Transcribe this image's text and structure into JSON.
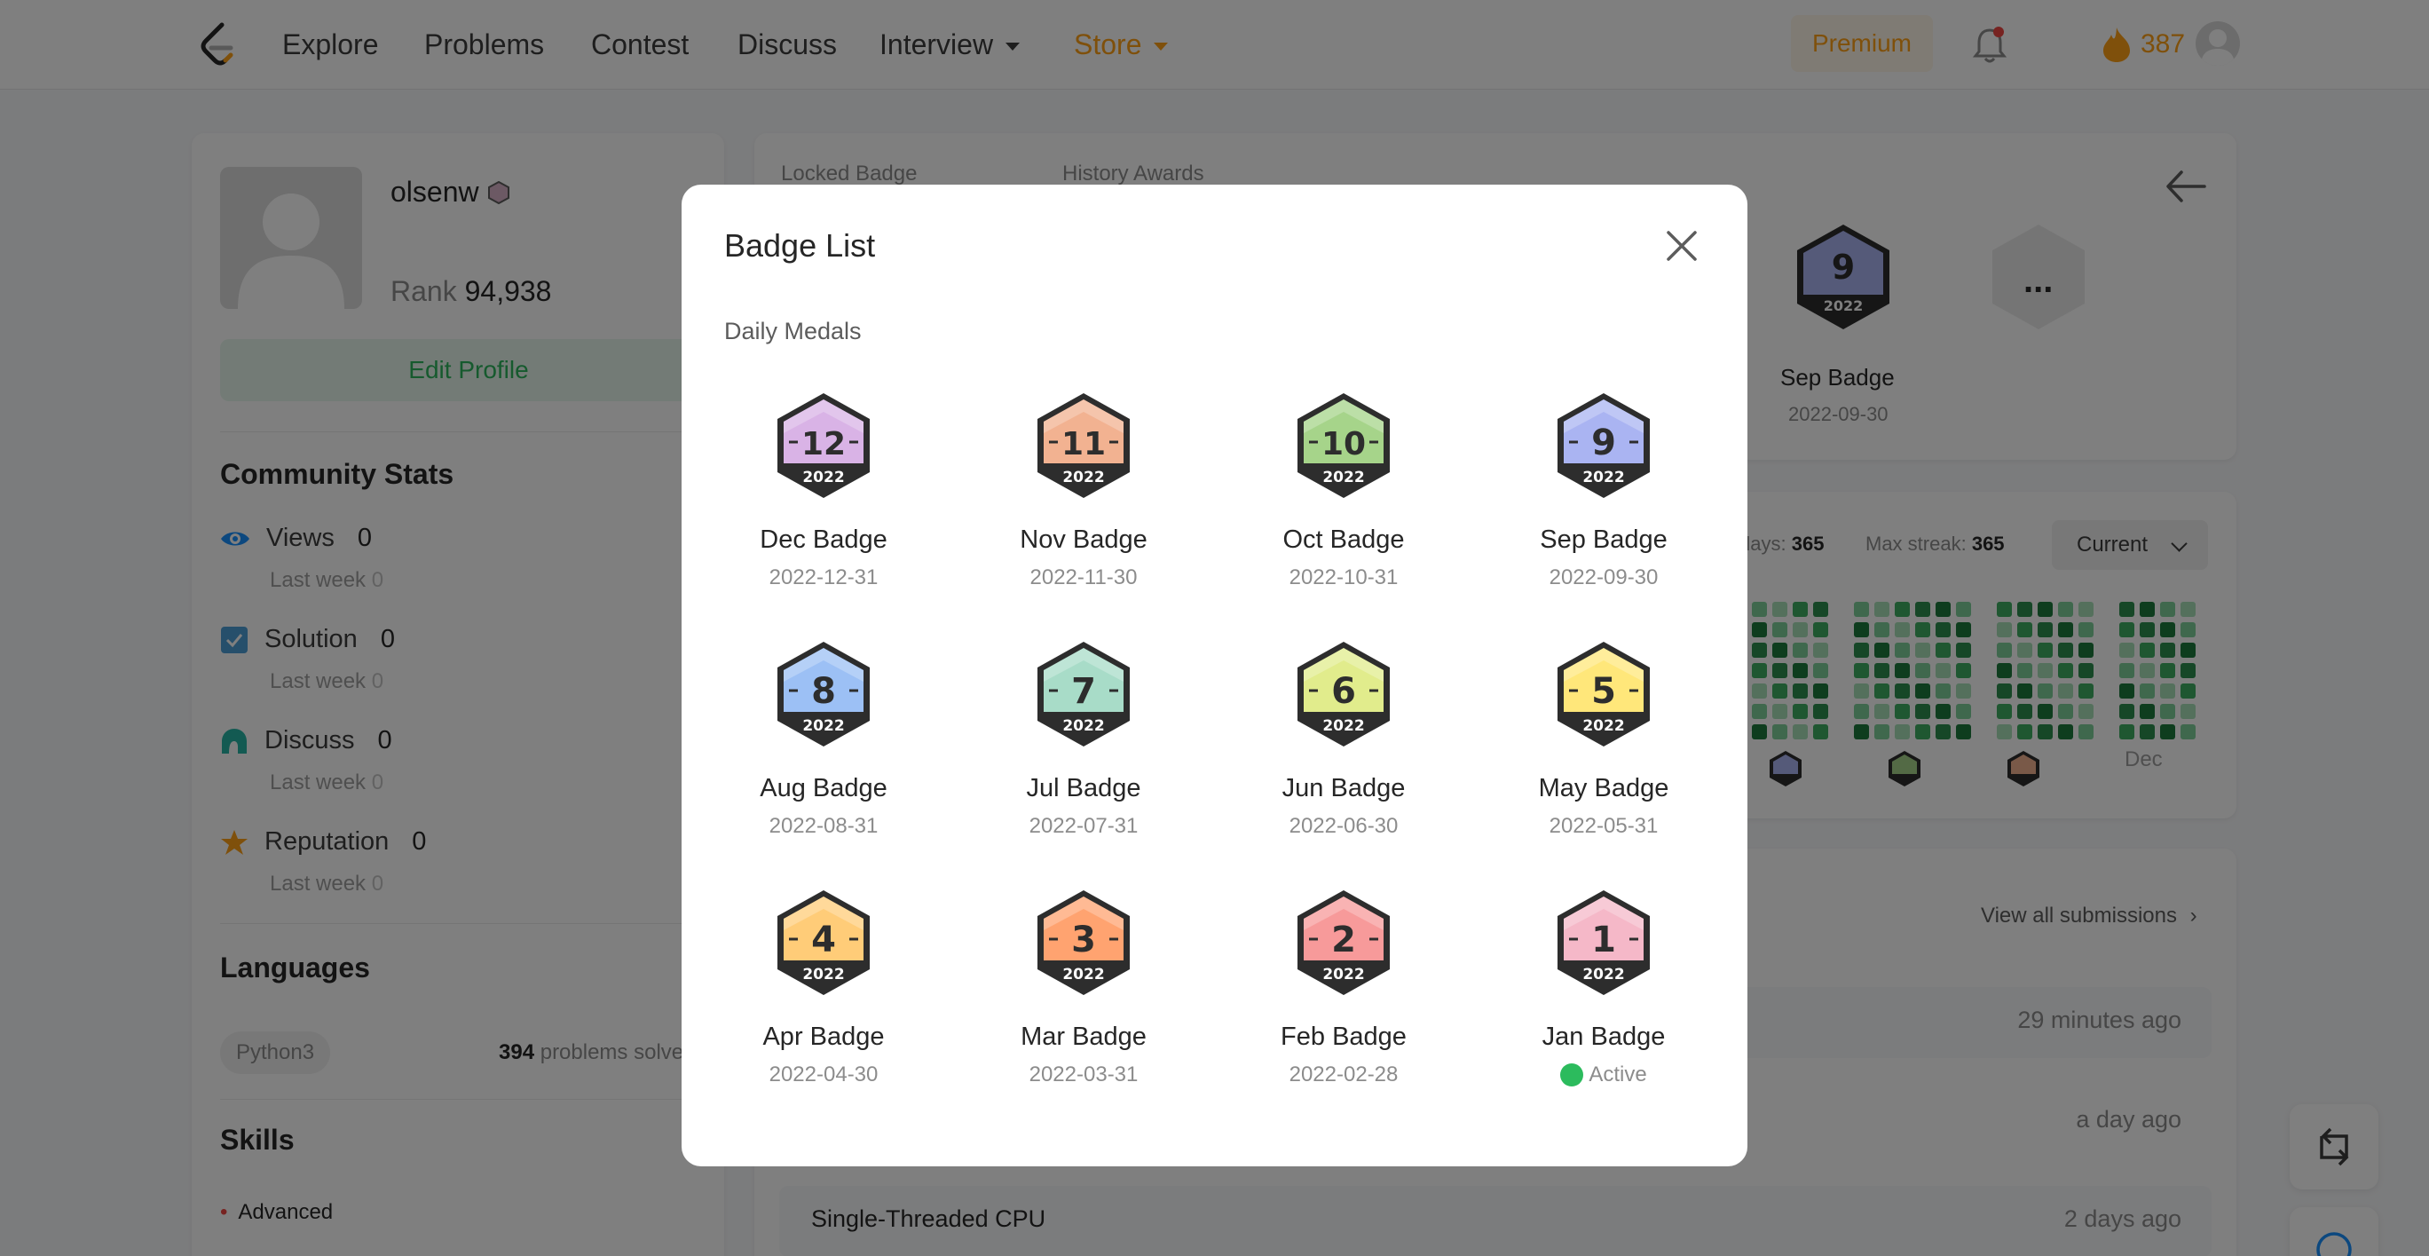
{
  "nav": {
    "links": [
      "Explore",
      "Problems",
      "Contest",
      "Discuss",
      "Interview",
      "Store"
    ],
    "premium": "Premium",
    "streak_count": "387",
    "accent_color": "#ffa116"
  },
  "profile": {
    "username": "olsenw",
    "rank_label": "Rank",
    "rank_value": "94,938",
    "edit_profile": "Edit Profile"
  },
  "community": {
    "title": "Community Stats",
    "stats": [
      {
        "label": "Views",
        "value": "0",
        "sub_label": "Last week",
        "sub_value": "0",
        "icon": "eye-icon"
      },
      {
        "label": "Solution",
        "value": "0",
        "sub_label": "Last week",
        "sub_value": "0",
        "icon": "checkbox-icon"
      },
      {
        "label": "Discuss",
        "value": "0",
        "sub_label": "Last week",
        "sub_value": "0",
        "icon": "discuss-icon"
      },
      {
        "label": "Reputation",
        "value": "0",
        "sub_label": "Last week",
        "sub_value": "0",
        "icon": "star-icon"
      }
    ]
  },
  "languages": {
    "title": "Languages",
    "items": [
      {
        "name": "Python3",
        "count": "394",
        "suffix": "problems solve"
      }
    ]
  },
  "skills": {
    "title": "Skills",
    "level": "Advanced"
  },
  "badges_card": {
    "tabs": [
      "Locked Badge",
      "History Awards"
    ],
    "visible_badge": {
      "name": "Sep Badge",
      "date": "2022-09-30",
      "number": "9",
      "year": "2022"
    },
    "locked_badge_more": "..."
  },
  "calendar_card": {
    "total_days_label": "days:",
    "total_days_value": "365",
    "max_streak_label": "Max streak:",
    "max_streak_value": "365",
    "range_select": "Current",
    "month_label": "Dec"
  },
  "submissions_card": {
    "view_all": "View all submissions",
    "rows": [
      {
        "title": "",
        "time": "29 minutes ago"
      },
      {
        "title": "",
        "time": "a day ago"
      },
      {
        "title": "Single-Threaded CPU",
        "time": "2 days ago"
      }
    ]
  },
  "modal": {
    "title": "Badge List",
    "section": "Daily Medals",
    "badges": [
      {
        "number": "12",
        "year": "2022",
        "name": "Dec Badge",
        "date": "2022-12-31",
        "color": "#d9b3e6"
      },
      {
        "number": "11",
        "year": "2022",
        "name": "Nov Badge",
        "date": "2022-11-30",
        "color": "#f2b291"
      },
      {
        "number": "10",
        "year": "2022",
        "name": "Oct Badge",
        "date": "2022-10-31",
        "color": "#a6d48a"
      },
      {
        "number": "9",
        "year": "2022",
        "name": "Sep Badge",
        "date": "2022-09-30",
        "color": "#aab4f2"
      },
      {
        "number": "8",
        "year": "2022",
        "name": "Aug Badge",
        "date": "2022-08-31",
        "color": "#9cc0f5"
      },
      {
        "number": "7",
        "year": "2022",
        "name": "Jul Badge",
        "date": "2022-07-31",
        "color": "#a8dcc8"
      },
      {
        "number": "6",
        "year": "2022",
        "name": "Jun Badge",
        "date": "2022-06-30",
        "color": "#e1ec8c"
      },
      {
        "number": "5",
        "year": "2022",
        "name": "May Badge",
        "date": "2022-05-31",
        "color": "#ffe77a"
      },
      {
        "number": "4",
        "year": "2022",
        "name": "Apr Badge",
        "date": "2022-04-30",
        "color": "#ffcc78"
      },
      {
        "number": "3",
        "year": "2022",
        "name": "Mar Badge",
        "date": "2022-03-31",
        "color": "#ffa370"
      },
      {
        "number": "2",
        "year": "2022",
        "name": "Feb Badge",
        "date": "2022-02-28",
        "color": "#f79a9a"
      },
      {
        "number": "1",
        "year": "2022",
        "name": "Jan Badge",
        "date": "Active",
        "color": "#f5b8c8",
        "active": true
      }
    ]
  }
}
